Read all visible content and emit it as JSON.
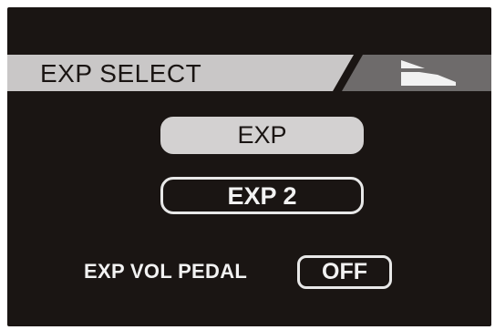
{
  "header": {
    "title": "EXP SELECT",
    "icon": "expression-pedal-icon"
  },
  "options": [
    {
      "label": "EXP",
      "selected": true
    },
    {
      "label": "EXP 2",
      "selected": false
    }
  ],
  "vol_pedal": {
    "label": "EXP VOL PEDAL",
    "value": "OFF"
  },
  "colors": {
    "screen_bg": "#1a1513",
    "header_light": "#c9c7c7",
    "header_dark": "#6e6b6b",
    "text_light": "#f2f2f2",
    "selected_bg": "#d3d1d1"
  }
}
